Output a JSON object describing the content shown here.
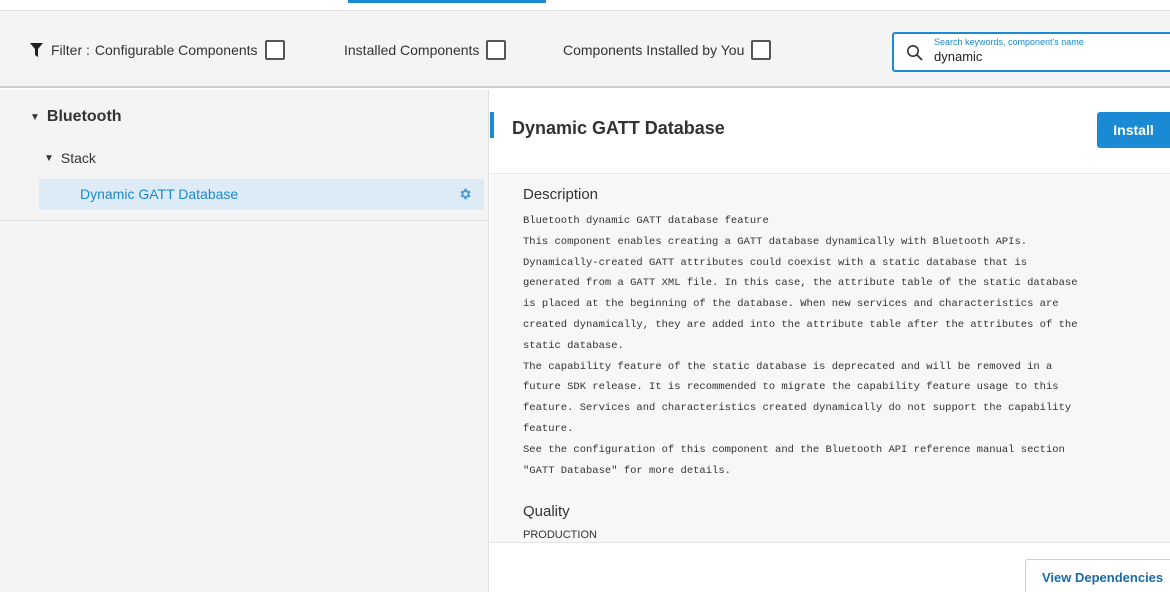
{
  "filter": {
    "label": "Filter :",
    "options": [
      {
        "label": "Configurable Components",
        "checked": false
      },
      {
        "label": "Installed Components",
        "checked": false
      },
      {
        "label": "Components Installed by You",
        "checked": false
      }
    ]
  },
  "search": {
    "placeholder": "Search keywords, component's name",
    "value": "dynamic"
  },
  "tree": {
    "category": "Bluetooth",
    "subcategory": "Stack",
    "selected_item": "Dynamic GATT Database"
  },
  "detail": {
    "title": "Dynamic GATT Database",
    "install_label": "Install",
    "description_heading": "Description",
    "description_lines": [
      "Bluetooth dynamic GATT database feature",
      "This component enables creating a GATT database dynamically with Bluetooth APIs.",
      "Dynamically-created GATT attributes could coexist with a static database that is",
      "generated from a GATT XML file. In this case, the attribute table of the static database",
      "is placed at the beginning of the database. When new services and characteristics are",
      "created dynamically, they are added into the attribute table after the attributes of the",
      "static database.",
      "The capability feature of the static database is deprecated and will be removed in a",
      "future SDK release. It is recommended to migrate the capability feature usage to this",
      "feature. Services and characteristics created dynamically do not support the capability",
      "feature.",
      "See the configuration of this component and the Bluetooth API reference manual section",
      "\"GATT Database\" for more details."
    ],
    "quality_heading": "Quality",
    "quality_value": "PRODUCTION",
    "view_dependencies_label": "View Dependencies"
  },
  "colors": {
    "accent": "#1a8ad4",
    "selected_row": "#dcebf5",
    "panel_bg": "#f4f4f4"
  },
  "icons": [
    "filter-icon",
    "search-icon",
    "caret-down-icon",
    "gear-icon"
  ]
}
